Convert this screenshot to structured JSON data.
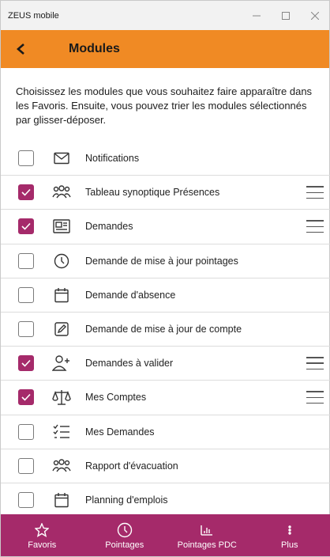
{
  "window": {
    "title": "ZEUS mobile",
    "controls": [
      "minimize",
      "maximize",
      "close"
    ]
  },
  "header": {
    "title": "Modules",
    "back_icon": "chevron-left-icon",
    "color": "#f08a24"
  },
  "intro_text": "Choisissez les modules que vous souhaitez faire apparaître dans les Favoris. Ensuite, vous pouvez trier les modules sélectionnés par glisser-déposer.",
  "modules": [
    {
      "label": "Notifications",
      "icon": "envelope-icon",
      "checked": false
    },
    {
      "label": "Tableau synoptique Présences",
      "icon": "people-group-icon",
      "checked": true
    },
    {
      "label": "Demandes",
      "icon": "newspaper-icon",
      "checked": true
    },
    {
      "label": "Demande de mise à jour pointages",
      "icon": "clock-icon",
      "checked": false
    },
    {
      "label": "Demande d'absence",
      "icon": "calendar-icon",
      "checked": false
    },
    {
      "label": "Demande de mise à jour de compte",
      "icon": "edit-icon",
      "checked": false
    },
    {
      "label": "Demandes à valider",
      "icon": "person-add-icon",
      "checked": true
    },
    {
      "label": "Mes Comptes",
      "icon": "scales-icon",
      "checked": true
    },
    {
      "label": "Mes Demandes",
      "icon": "checklist-icon",
      "checked": false
    },
    {
      "label": "Rapport d'évacuation",
      "icon": "people-group-icon",
      "checked": false
    },
    {
      "label": "Planning d'emplois",
      "icon": "calendar-icon",
      "checked": false
    }
  ],
  "bottom_nav": {
    "color": "#a52a6a",
    "items": [
      {
        "label": "Favoris",
        "icon": "star-icon"
      },
      {
        "label": "Pointages",
        "icon": "clock-icon"
      },
      {
        "label": "Pointages PDC",
        "icon": "bar-chart-icon"
      },
      {
        "label": "Plus",
        "icon": "more-vertical-icon"
      }
    ]
  }
}
